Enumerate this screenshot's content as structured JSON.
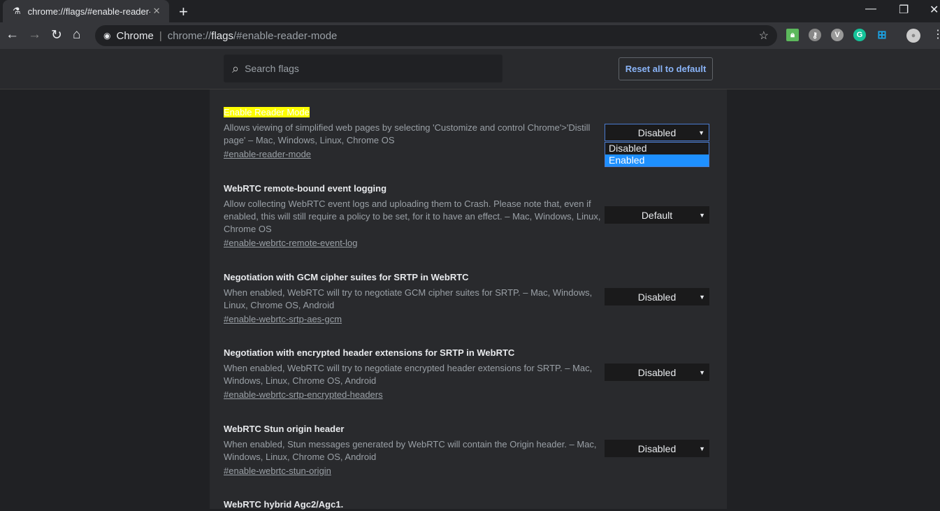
{
  "browser": {
    "tab_title": "chrome://flags/#enable-reader-mode",
    "origin_label": "Chrome",
    "url_prefix": "chrome://",
    "url_host": "flags",
    "url_rest": "/#enable-reader-mode"
  },
  "extensions": [
    "lock-extension",
    "key-extension",
    "v-extension",
    "grammarly-extension",
    "windows-extension"
  ],
  "header": {
    "search_placeholder": "Search flags",
    "reset_label": "Reset all to default"
  },
  "flags": [
    {
      "name": "Enable Reader Mode",
      "highlighted": true,
      "desc": "Allows viewing of simplified web pages by selecting 'Customize and control Chrome'>'Distill page' – Mac, Windows, Linux, Chrome OS",
      "link": "#enable-reader-mode",
      "value": "Disabled",
      "open": true,
      "options": [
        "Disabled",
        "Enabled"
      ],
      "hovered_option": "Enabled"
    },
    {
      "name": "WebRTC remote-bound event logging",
      "desc": "Allow collecting WebRTC event logs and uploading them to Crash. Please note that, even if enabled, this will still require a policy to be set, for it to have an effect. – Mac, Windows, Linux, Chrome OS",
      "link": "#enable-webrtc-remote-event-log",
      "value": "Default"
    },
    {
      "name": "Negotiation with GCM cipher suites for SRTP in WebRTC",
      "desc": "When enabled, WebRTC will try to negotiate GCM cipher suites for SRTP. – Mac, Windows, Linux, Chrome OS, Android",
      "link": "#enable-webrtc-srtp-aes-gcm",
      "value": "Disabled"
    },
    {
      "name": "Negotiation with encrypted header extensions for SRTP in WebRTC",
      "desc": "When enabled, WebRTC will try to negotiate encrypted header extensions for SRTP. – Mac, Windows, Linux, Chrome OS, Android",
      "link": "#enable-webrtc-srtp-encrypted-headers",
      "value": "Disabled"
    },
    {
      "name": "WebRTC Stun origin header",
      "desc": "When enabled, Stun messages generated by WebRTC will contain the Origin header. – Mac, Windows, Linux, Chrome OS, Android",
      "link": "#enable-webrtc-stun-origin",
      "value": "Disabled"
    },
    {
      "name": "WebRTC hybrid Agc2/Agc1."
    }
  ]
}
